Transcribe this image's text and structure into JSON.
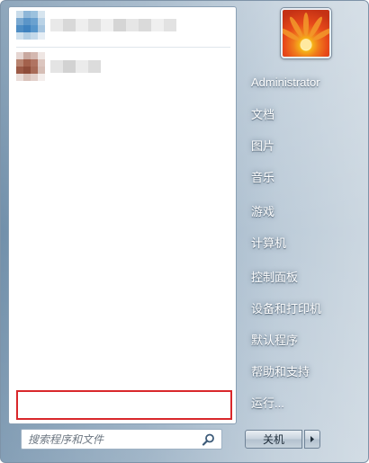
{
  "right_pane": {
    "user_name": "Administrator",
    "items": [
      {
        "label": "文档"
      },
      {
        "label": "图片"
      },
      {
        "label": "音乐"
      },
      {
        "label": "游戏"
      },
      {
        "label": "计算机"
      },
      {
        "label": "控制面板"
      },
      {
        "label": "设备和打印机"
      },
      {
        "label": "默认程序"
      },
      {
        "label": "帮助和支持"
      },
      {
        "label": "运行..."
      }
    ]
  },
  "search": {
    "placeholder": "搜索程序和文件",
    "value": ""
  },
  "shutdown": {
    "label": "关机"
  },
  "icons": {
    "search": "search-icon",
    "shutdown_arrow": "arrow-right-icon",
    "avatar": "flower-icon"
  },
  "colors": {
    "highlight_border": "#d9272b",
    "menu_text": "#ffffff"
  }
}
